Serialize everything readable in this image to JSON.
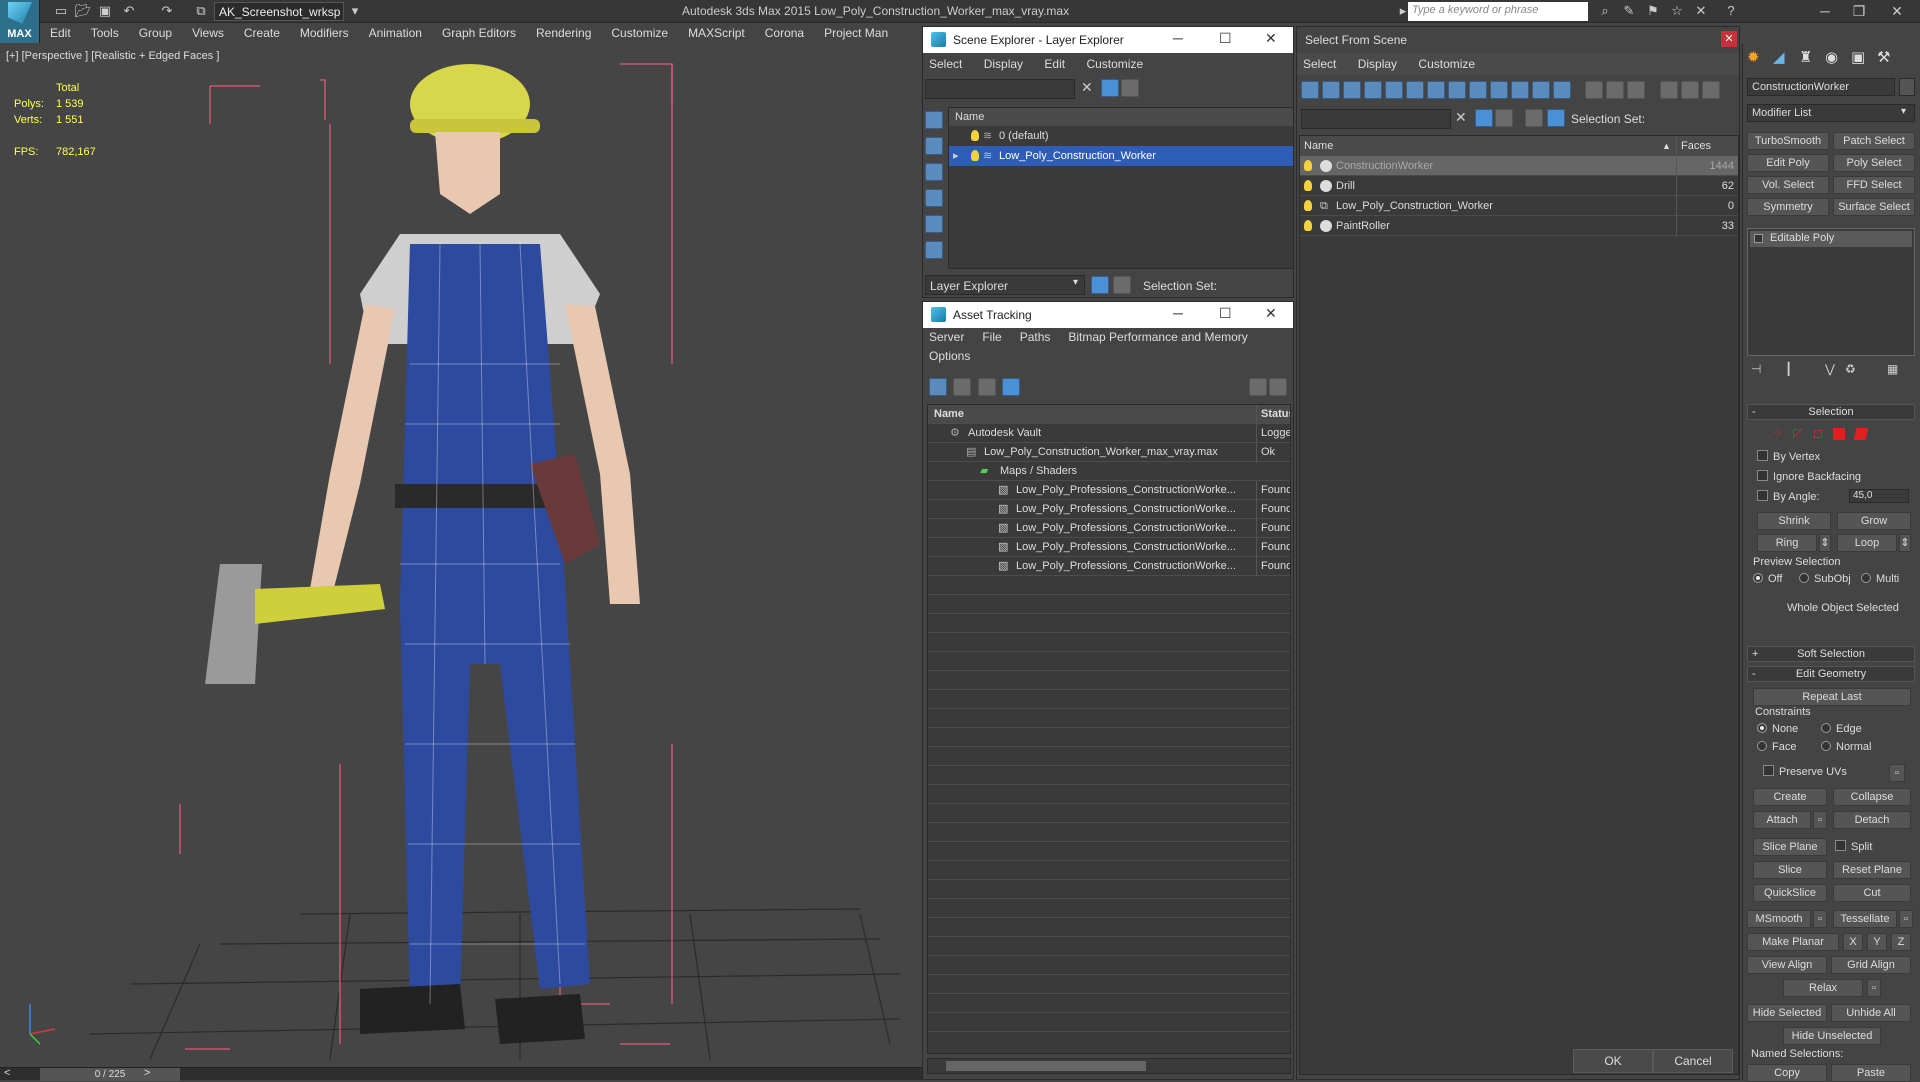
{
  "app": {
    "logo": "MAX",
    "title": "Autodesk 3ds Max  2015    Low_Poly_Construction_Worker_max_vray.max",
    "workspace": "AK_Screenshot_wrksp",
    "search_placeholder": "Type a keyword or phrase"
  },
  "menu": [
    "Edit",
    "Tools",
    "Group",
    "Views",
    "Create",
    "Modifiers",
    "Animation",
    "Graph Editors",
    "Rendering",
    "Customize",
    "MAXScript",
    "Corona",
    "Project Man"
  ],
  "viewport": {
    "label": "[+] [Perspective ] [Realistic + Edged Faces ]",
    "stats": {
      "header": "Total",
      "polys_label": "Polys:",
      "polys": "1 539",
      "verts_label": "Verts:",
      "verts": "1 551",
      "fps_label": "FPS:",
      "fps": "782,167"
    },
    "timeline": "0 / 225",
    "colors": {
      "overall": "#2e4a9e",
      "skin": "#e8c8b0",
      "helmet": "#d8d64a",
      "shirt": "#cfcfcf",
      "grid": "#2b2b2b",
      "bbox": "#e05a7a"
    }
  },
  "scene_explorer": {
    "title": "Scene Explorer - Layer Explorer",
    "menu": [
      "Select",
      "Display",
      "Edit",
      "Customize"
    ],
    "column": "Name",
    "rows": [
      "0 (default)",
      "Low_Poly_Construction_Worker"
    ],
    "footer_label": "Layer Explorer",
    "selection_set": "Selection Set:"
  },
  "asset_tracking": {
    "title": "Asset Tracking",
    "menu1": [
      "Server",
      "File",
      "Paths",
      "Bitmap Performance and Memory"
    ],
    "menu2": [
      "Options"
    ],
    "col_name": "Name",
    "col_status": "Status",
    "rows": [
      {
        "name": "Autodesk Vault",
        "status": "Logge"
      },
      {
        "name": "Low_Poly_Construction_Worker_max_vray.max",
        "status": "Ok"
      },
      {
        "name": "Maps / Shaders",
        "status": ""
      },
      {
        "name": "Low_Poly_Professions_ConstructionWorke...",
        "status": "Found"
      },
      {
        "name": "Low_Poly_Professions_ConstructionWorke...",
        "status": "Found"
      },
      {
        "name": "Low_Poly_Professions_ConstructionWorke...",
        "status": "Found"
      },
      {
        "name": "Low_Poly_Professions_ConstructionWorke...",
        "status": "Found"
      },
      {
        "name": "Low_Poly_Professions_ConstructionWorke...",
        "status": "Found"
      }
    ]
  },
  "select_from_scene": {
    "title": "Select From Scene",
    "menu": [
      "Select",
      "Display",
      "Customize"
    ],
    "selection_set": "Selection Set:",
    "col_name": "Name",
    "col_faces": "Faces",
    "rows": [
      {
        "name": "ConstructionWorker",
        "faces": "1444"
      },
      {
        "name": "Drill",
        "faces": "62"
      },
      {
        "name": "Low_Poly_Construction_Worker",
        "faces": "0"
      },
      {
        "name": "PaintRoller",
        "faces": "33"
      }
    ],
    "ok": "OK",
    "cancel": "Cancel"
  },
  "command_panel": {
    "object_name": "ConstructionWorker",
    "modifier_list": "Modifier List",
    "mod_buttons": [
      "TurboSmooth",
      "Patch Select",
      "Edit Poly",
      "Poly Select",
      "Vol. Select",
      "FFD Select",
      "Symmetry",
      "Surface Select"
    ],
    "stack_item": "Editable Poly",
    "selection": {
      "title": "Selection",
      "by_vertex": "By Vertex",
      "ignore_backfacing": "Ignore Backfacing",
      "by_angle": "By Angle:",
      "angle_value": "45,0",
      "shrink": "Shrink",
      "grow": "Grow",
      "ring": "Ring",
      "loop": "Loop",
      "preview": "Preview Selection",
      "off": "Off",
      "subobj": "SubObj",
      "multi": "Multi",
      "status": "Whole Object Selected"
    },
    "soft_selection": "Soft Selection",
    "edit_geometry": {
      "title": "Edit Geometry",
      "repeat_last": "Repeat Last",
      "constraints": "Constraints",
      "none": "None",
      "edge": "Edge",
      "face": "Face",
      "normal": "Normal",
      "preserve_uvs": "Preserve UVs",
      "create": "Create",
      "collapse": "Collapse",
      "attach": "Attach",
      "detach": "Detach",
      "slice_plane": "Slice Plane",
      "split": "Split",
      "slice": "Slice",
      "reset_plane": "Reset Plane",
      "quickslice": "QuickSlice",
      "cut": "Cut",
      "msmooth": "MSmooth",
      "tessellate": "Tessellate",
      "make_planar": "Make Planar",
      "x": "X",
      "y": "Y",
      "z": "Z",
      "view_align": "View Align",
      "grid_align": "Grid Align",
      "relax": "Relax",
      "hide_selected": "Hide Selected",
      "unhide_all": "Unhide All",
      "hide_unselected": "Hide Unselected",
      "named_selections": "Named Selections:",
      "copy": "Copy",
      "paste": "Paste"
    }
  }
}
